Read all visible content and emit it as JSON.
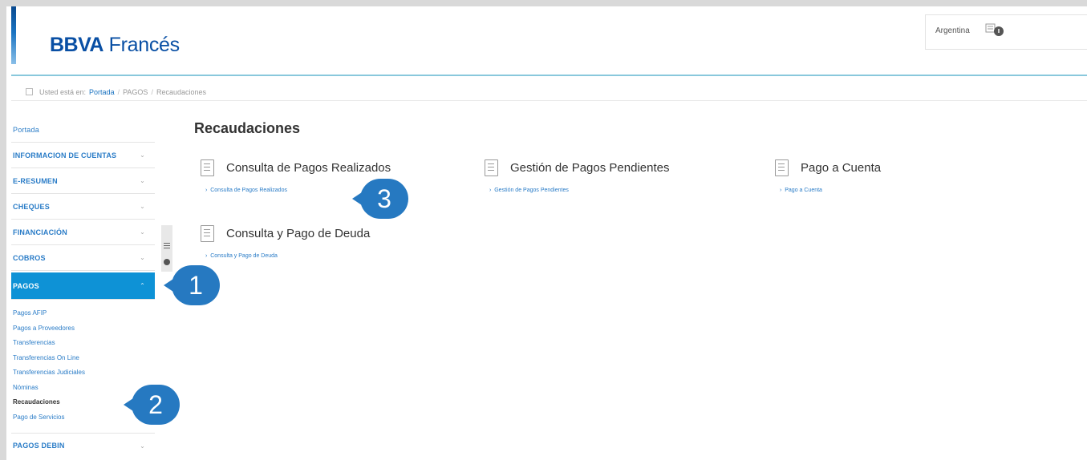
{
  "header": {
    "logo_bold": "BBVA",
    "logo_rest": " Francés",
    "country": "Argentina"
  },
  "breadcrumb": {
    "prefix": "Usted está en:",
    "items": [
      "Portada",
      "PAGOS",
      "Recaudaciones"
    ]
  },
  "sidebar": {
    "items": [
      {
        "label": "Portada"
      },
      {
        "label": "INFORMACION DE CUENTAS",
        "chevron": "⌄"
      },
      {
        "label": "E-RESUMEN",
        "chevron": "⌄"
      },
      {
        "label": "CHEQUES",
        "chevron": "⌄"
      },
      {
        "label": "FINANCIACIÓN",
        "chevron": "⌄"
      },
      {
        "label": "COBROS",
        "chevron": "⌄"
      },
      {
        "label": "PAGOS",
        "chevron": "⌃"
      }
    ],
    "submenu": [
      "Pagos AFIP",
      "Pagos a Proveedores",
      "Transferencias",
      "Transferencias On Line",
      "Transferencias Judiciales",
      "Nóminas",
      "Recaudaciones",
      "Pago de Servicios"
    ],
    "current_sub": "Recaudaciones",
    "last_item": {
      "label": "PAGOS DEBIN",
      "chevron": "⌄"
    }
  },
  "main": {
    "title": "Recaudaciones",
    "sections": [
      {
        "title": "Consulta de Pagos Realizados",
        "link": "Consulta de Pagos Realizados",
        "icon": "document-icon"
      },
      {
        "title": "Gestión de Pagos Pendientes",
        "link": "Gestión de Pagos Pendientes",
        "icon": "document-icon"
      },
      {
        "title": "Pago a Cuenta",
        "link": "Pago a Cuenta",
        "icon": "document-icon"
      },
      {
        "title": "Consulta y Pago de Deuda",
        "link": "Consulta y Pago de Deuda",
        "icon": "document-icon"
      }
    ]
  },
  "annotations": {
    "one": "1",
    "two": "2",
    "three": "3",
    "color": "#2679c1"
  },
  "colors": {
    "brand": "#094fa4",
    "active_menu": "#0e92d6",
    "link": "#2a7cc7"
  }
}
